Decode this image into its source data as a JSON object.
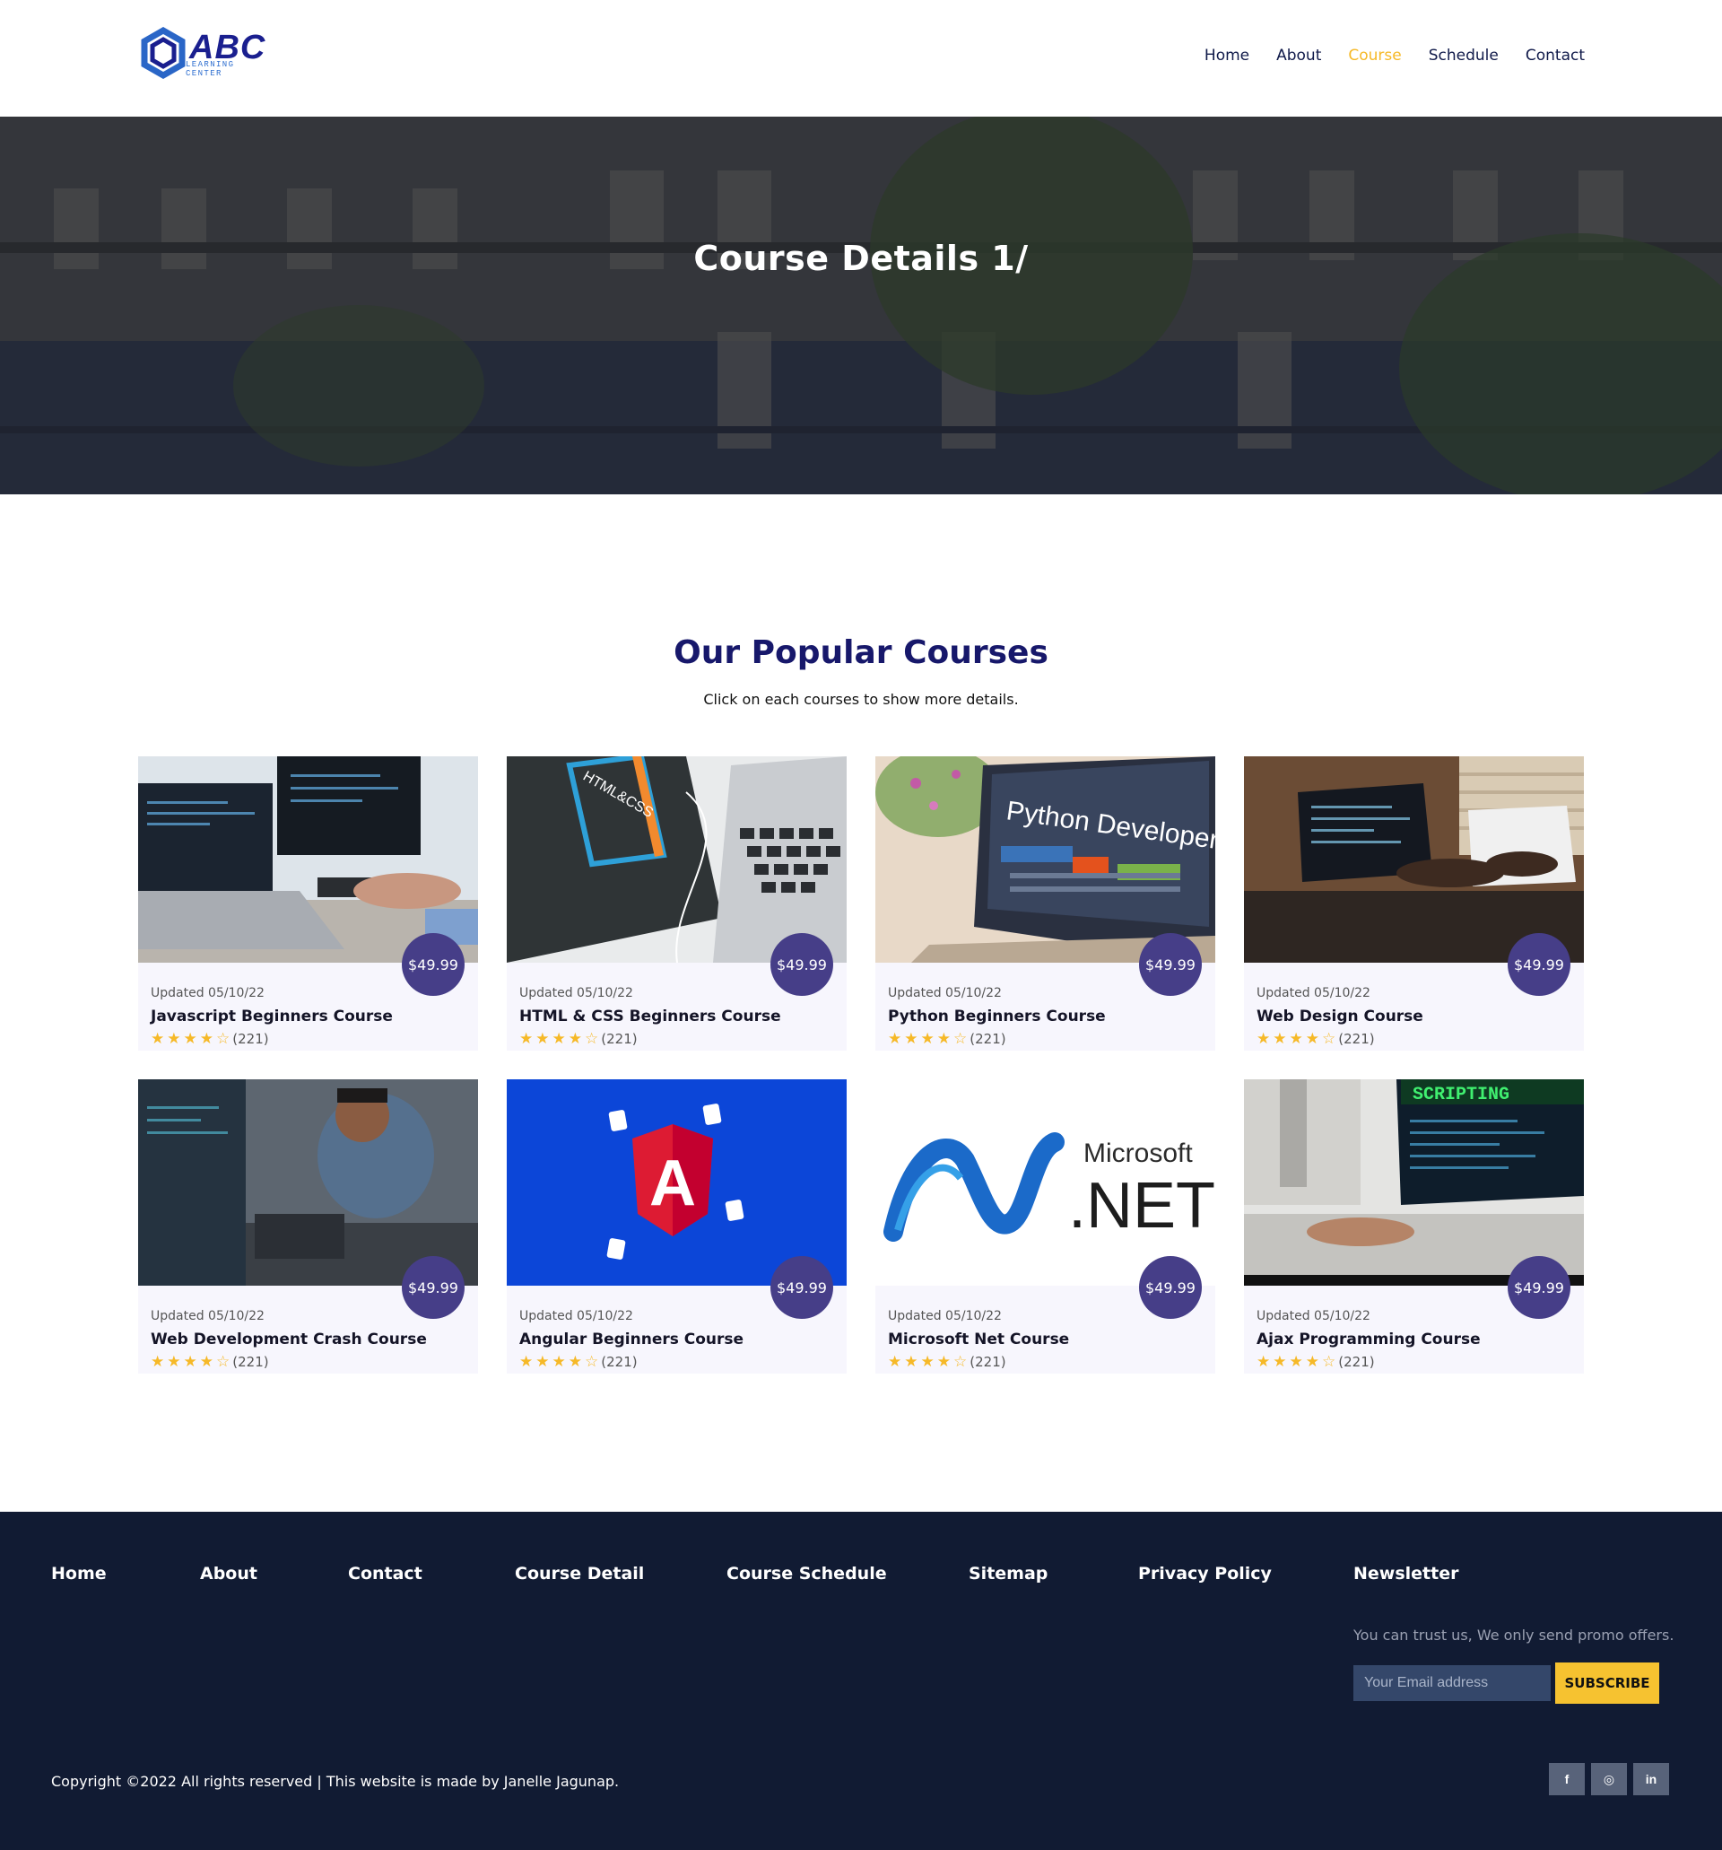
{
  "brand": {
    "name": "ABC",
    "sub": "LEARNING CENTER",
    "color": "#1a1f8f"
  },
  "nav": [
    {
      "label": "Home",
      "active": false
    },
    {
      "label": "About",
      "active": false
    },
    {
      "label": "Course",
      "active": true
    },
    {
      "label": "Schedule",
      "active": false
    },
    {
      "label": "Contact",
      "active": false
    }
  ],
  "hero": {
    "title": "Course Details 1/"
  },
  "section": {
    "title": "Our Popular Courses",
    "subtitle": "Click on each courses to show more details."
  },
  "courses": [
    {
      "name": "Javascript Beginners Course",
      "updated": "Updated 05/10/22",
      "price": "$49.99",
      "rating_count": "(221)",
      "stars": 4,
      "image": "laptop-code-photo"
    },
    {
      "name": "HTML & CSS Beginners Course",
      "updated": "Updated 05/10/22",
      "price": "$49.99",
      "rating_count": "(221)",
      "stars": 4,
      "image": "html-css-book-photo",
      "image_text": "HTML&CSS"
    },
    {
      "name": "Python Beginners Course",
      "updated": "Updated 05/10/22",
      "price": "$49.99",
      "rating_count": "(221)",
      "stars": 4,
      "image": "python-developer-photo",
      "image_text": "Python Developer"
    },
    {
      "name": "Web Design Course",
      "updated": "Updated 05/10/22",
      "price": "$49.99",
      "rating_count": "(221)",
      "stars": 4,
      "image": "laptop-desk-photo"
    },
    {
      "name": "Web Development Crash Course",
      "updated": "Updated 05/10/22",
      "price": "$49.99",
      "rating_count": "(221)",
      "stars": 4,
      "image": "developer-smiling-photo"
    },
    {
      "name": "Angular Beginners Course",
      "updated": "Updated 05/10/22",
      "price": "$49.99",
      "rating_count": "(221)",
      "stars": 4,
      "image": "angular-logo",
      "image_text": "A"
    },
    {
      "name": "Microsoft Net Course",
      "updated": "Updated 05/10/22",
      "price": "$49.99",
      "rating_count": "(221)",
      "stars": 4,
      "image": "microsoft-net-logo",
      "image_text": "Microsoft .NET"
    },
    {
      "name": "Ajax Programming Course",
      "updated": "Updated 05/10/22",
      "price": "$49.99",
      "rating_count": "(221)",
      "stars": 4,
      "image": "scripting-screen-photo",
      "image_text": "SCRIPTING"
    }
  ],
  "footer": {
    "links": [
      "Home",
      "About",
      "Contact",
      "Course Detail",
      "Course Schedule",
      "Sitemap",
      "Privacy Policy"
    ],
    "newsletter": {
      "title": "Newsletter",
      "promo": "You can trust us, We only send promo offers.",
      "placeholder": "Your Email address",
      "button": "SUBSCRIBE"
    },
    "copyright": "Copyright ©2022 All rights reserved | This website is made by Janelle Jagunap.",
    "socials": [
      {
        "icon": "facebook-icon",
        "glyph": "f"
      },
      {
        "icon": "instagram-icon",
        "glyph": "◎"
      },
      {
        "icon": "linkedin-icon",
        "glyph": "in"
      }
    ]
  },
  "colors": {
    "accent": "#f6b928",
    "price_badge": "#463e88",
    "footer_bg": "#111b33",
    "heading": "#17186b"
  }
}
